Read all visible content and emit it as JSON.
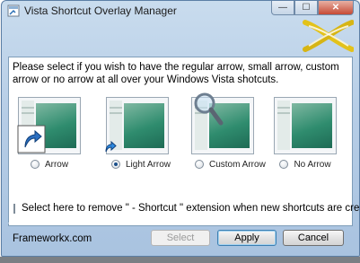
{
  "window": {
    "title": "Vista Shortcut Overlay Manager",
    "buttons": {
      "minimize_glyph": "—",
      "maximize_glyph": "☐",
      "close_glyph": "✕"
    }
  },
  "instructions": "Please select if you wish to have the regular arrow, small arrow, custom arrow or no arrow at all over your Windows Vista shotcuts.",
  "options": [
    {
      "label": "Arrow",
      "checked": false,
      "overlay": "large-arrow-icon"
    },
    {
      "label": "Light Arrow",
      "checked": true,
      "overlay": "small-arrow-icon"
    },
    {
      "label": "Custom Arrow",
      "checked": false,
      "overlay": "magnifier-icon"
    },
    {
      "label": "No Arrow",
      "checked": false,
      "overlay": "none"
    }
  ],
  "remove_extension": {
    "label": "Select here to remove \" - Shortcut \" extension when new shortcuts are created.",
    "checked": false
  },
  "footer": {
    "site": "Frameworkx.com",
    "select_label": "Select",
    "apply_label": "Apply",
    "cancel_label": "Cancel"
  },
  "colors": {
    "accent": "#3c7fb1",
    "preview_green": "#2f8c6e",
    "logo_yellow": "#e3c21a"
  }
}
